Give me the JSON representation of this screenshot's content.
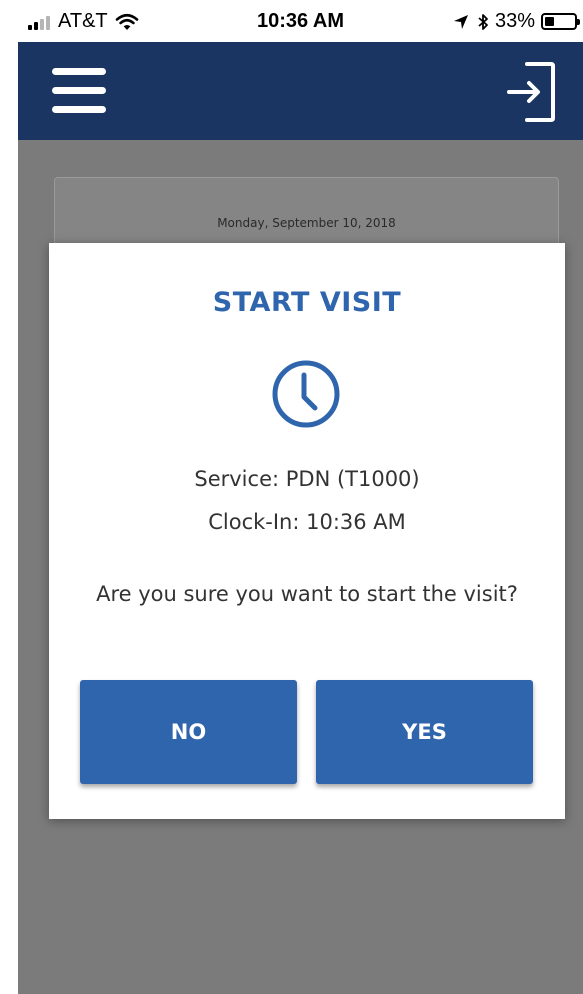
{
  "status_bar": {
    "carrier": "AT&T",
    "time": "10:36 AM",
    "battery": "33%",
    "battery_level": 0.33,
    "icons": [
      "signal-icon",
      "wifi-icon",
      "location-arrow-icon",
      "bluetooth-icon",
      "battery-icon"
    ]
  },
  "header": {
    "background_color": "#1b3562",
    "icons": [
      "menu-icon",
      "logout-icon"
    ]
  },
  "background_card": {
    "date": "Monday, September 10, 2018"
  },
  "modal": {
    "title": "START VISIT",
    "icon": "clock-icon",
    "service": "Service: PDN (T1000)",
    "clock_in": "Clock-In: 10:36 AM",
    "question": "Are you sure you want to start the visit?",
    "buttons": {
      "no_label": "NO",
      "yes_label": "YES"
    },
    "accent_color": "#2f65ad"
  }
}
